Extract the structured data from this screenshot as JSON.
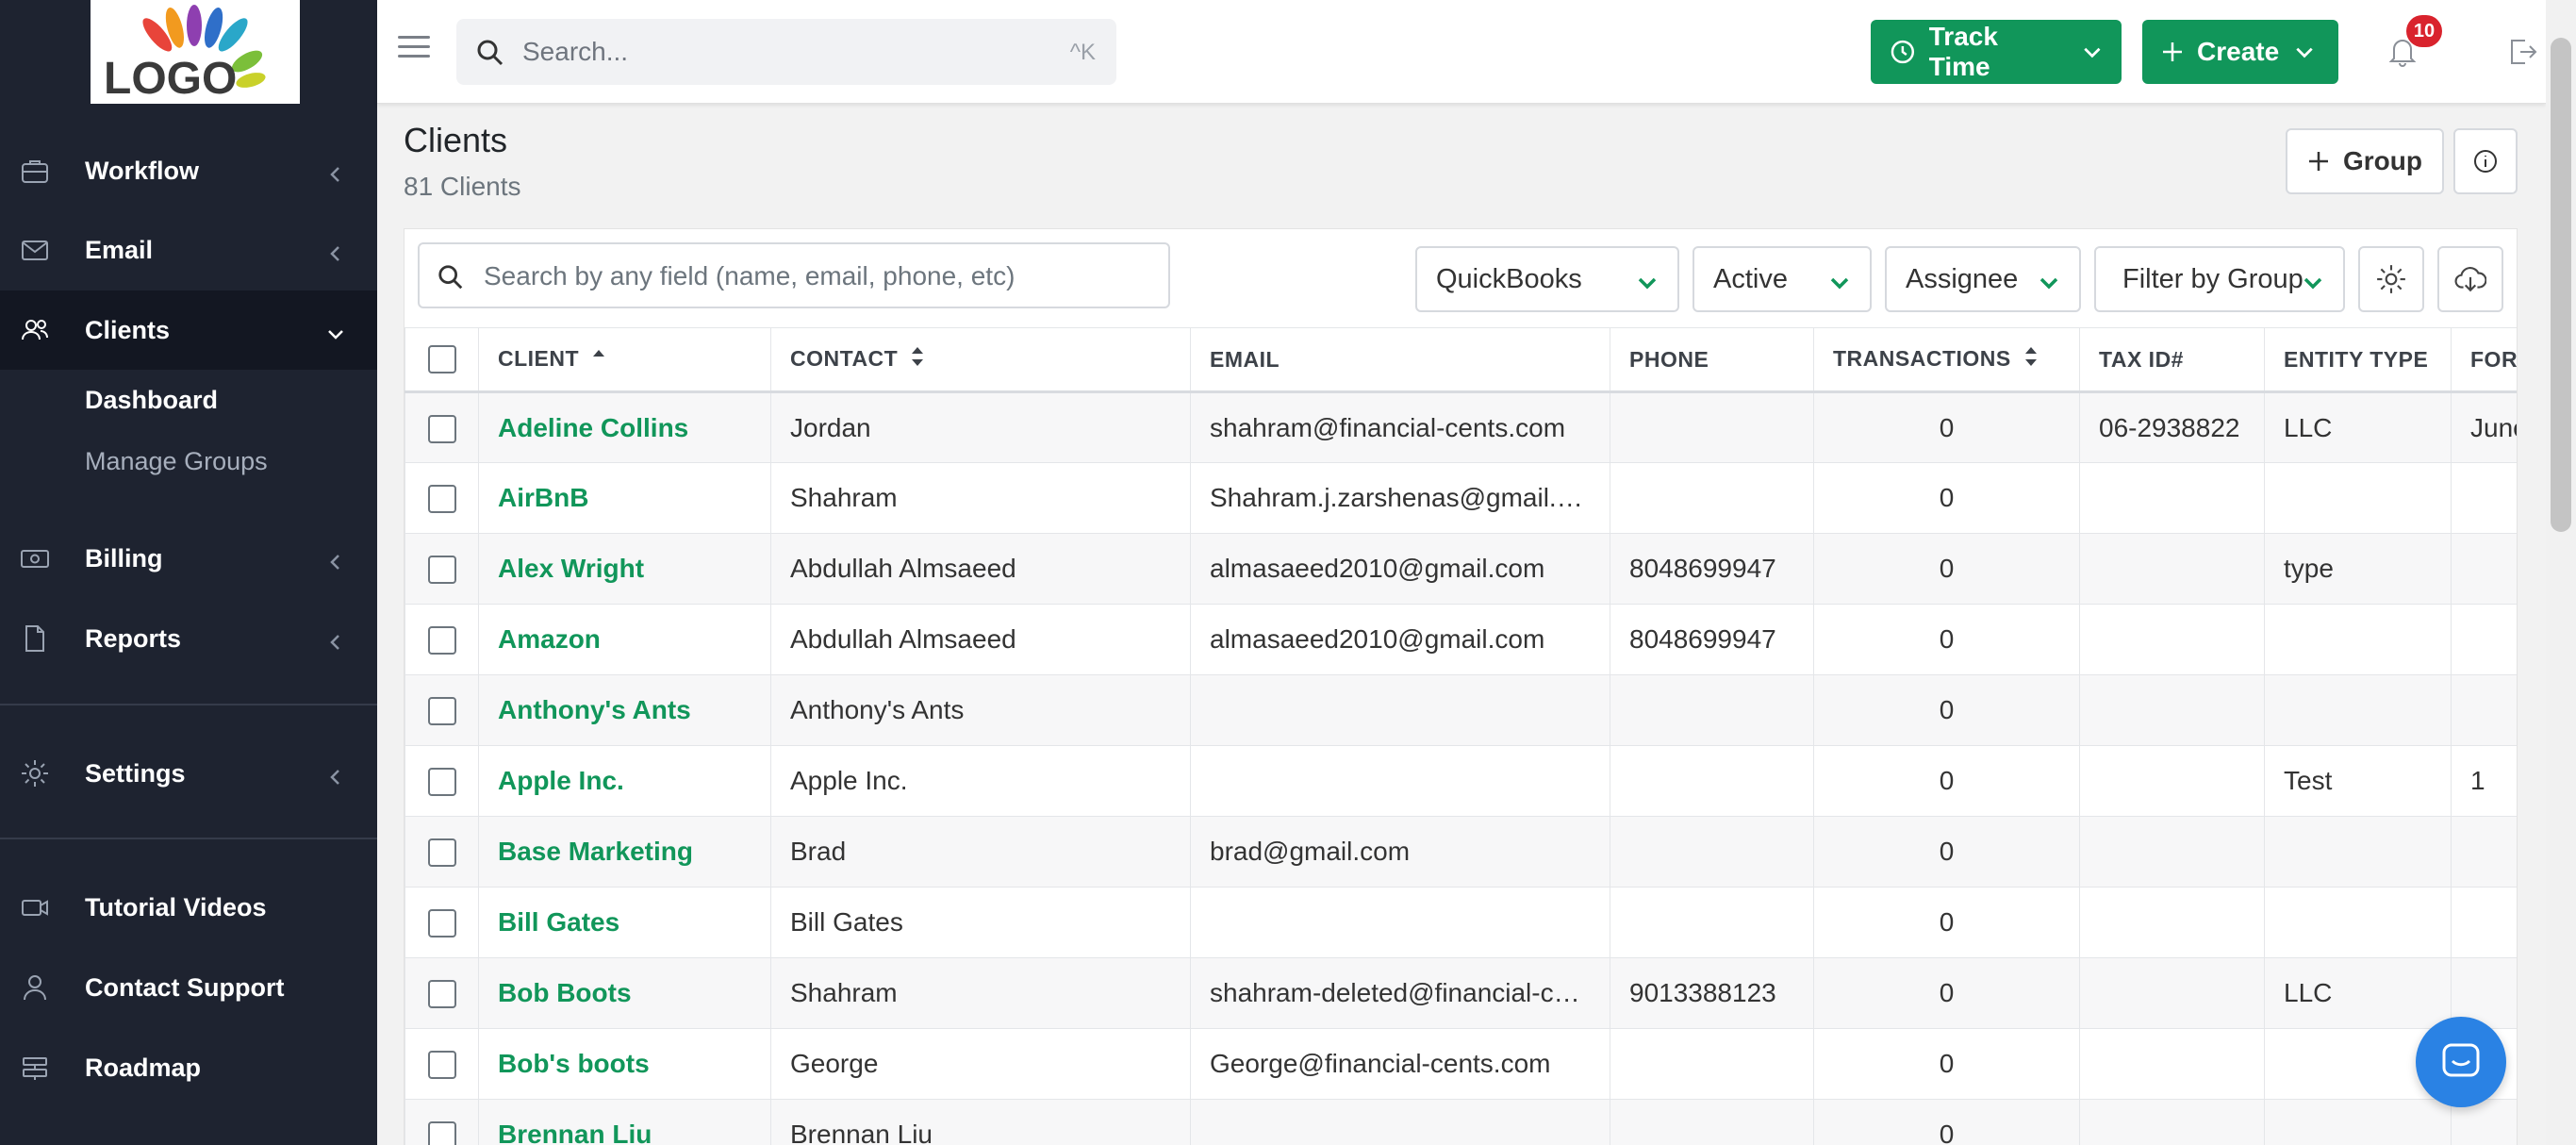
{
  "logo": {
    "text": "LOGO"
  },
  "sidebar": {
    "items": [
      {
        "label": "Workflow",
        "icon": "briefcase-icon"
      },
      {
        "label": "Email",
        "icon": "envelope-icon"
      },
      {
        "label": "Clients",
        "icon": "users-icon"
      },
      {
        "label": "Billing",
        "icon": "money-icon"
      },
      {
        "label": "Reports",
        "icon": "document-icon"
      },
      {
        "label": "Settings",
        "icon": "gear-icon"
      },
      {
        "label": "Tutorial Videos",
        "icon": "video-icon"
      },
      {
        "label": "Contact Support",
        "icon": "person-icon"
      },
      {
        "label": "Roadmap",
        "icon": "roadmap-icon"
      }
    ],
    "clients_sub": [
      {
        "label": "Dashboard"
      },
      {
        "label": "Manage Groups"
      }
    ]
  },
  "topbar": {
    "search_placeholder": "Search...",
    "search_shortcut": "^K",
    "track_time_label": "Track Time",
    "create_label": "Create",
    "notification_count": "10"
  },
  "page": {
    "title": "Clients",
    "subtitle": "81 Clients",
    "group_button": "Group"
  },
  "filters": {
    "search_placeholder": "Search by any field (name, email, phone, etc)",
    "quickbooks": "QuickBooks",
    "status": "Active",
    "assignee": "Assignee",
    "group": "Filter by Group"
  },
  "table": {
    "headers": {
      "client": "CLIENT",
      "contact": "CONTACT",
      "email": "EMAIL",
      "phone": "PHONE",
      "transactions": "TRANSACTIONS",
      "tax_id": "TAX ID#",
      "entity_type": "ENTITY TYPE",
      "formed": "FORM"
    },
    "rows": [
      {
        "client": "Adeline Collins",
        "contact": "Jordan",
        "email": "shahram@financial-cents.com",
        "phone": "",
        "transactions": "0",
        "tax_id": "06-2938822",
        "entity_type": "LLC",
        "formed": "June"
      },
      {
        "client": "AirBnB",
        "contact": "Shahram",
        "email": "Shahram.j.zarshenas@gmail.com",
        "phone": "",
        "transactions": "0",
        "tax_id": "",
        "entity_type": "",
        "formed": ""
      },
      {
        "client": "Alex Wright",
        "contact": "Abdullah Almsaeed",
        "email": "almasaeed2010@gmail.com",
        "phone": "8048699947",
        "transactions": "0",
        "tax_id": "",
        "entity_type": "type",
        "formed": ""
      },
      {
        "client": "Amazon",
        "contact": "Abdullah Almsaeed",
        "email": "almasaeed2010@gmail.com",
        "phone": "8048699947",
        "transactions": "0",
        "tax_id": "",
        "entity_type": "",
        "formed": ""
      },
      {
        "client": "Anthony's Ants",
        "contact": "Anthony's Ants",
        "email": "",
        "phone": "",
        "transactions": "0",
        "tax_id": "",
        "entity_type": "",
        "formed": ""
      },
      {
        "client": "Apple Inc.",
        "contact": "Apple Inc.",
        "email": "",
        "phone": "",
        "transactions": "0",
        "tax_id": "",
        "entity_type": "Test",
        "formed": "1"
      },
      {
        "client": "Base Marketing",
        "contact": "Brad",
        "email": "brad@gmail.com",
        "phone": "",
        "transactions": "0",
        "tax_id": "",
        "entity_type": "",
        "formed": ""
      },
      {
        "client": "Bill Gates",
        "contact": "Bill Gates",
        "email": "",
        "phone": "",
        "transactions": "0",
        "tax_id": "",
        "entity_type": "",
        "formed": ""
      },
      {
        "client": "Bob Boots",
        "contact": "Shahram",
        "email": "shahram-deleted@financial-cents.com",
        "phone": "9013388123",
        "transactions": "0",
        "tax_id": "",
        "entity_type": "LLC",
        "formed": ""
      },
      {
        "client": "Bob's boots",
        "contact": "George",
        "email": "George@financial-cents.com",
        "phone": "",
        "transactions": "0",
        "tax_id": "",
        "entity_type": "",
        "formed": ""
      },
      {
        "client": "Brennan Liu",
        "contact": "Brennan Liu",
        "email": "",
        "phone": "",
        "transactions": "0",
        "tax_id": "",
        "entity_type": "",
        "formed": ""
      }
    ]
  },
  "colors": {
    "sidebar_bg": "#1e2330",
    "accent_green": "#11965a",
    "badge_red": "#d9232d",
    "chat_blue": "#2a82e4"
  }
}
